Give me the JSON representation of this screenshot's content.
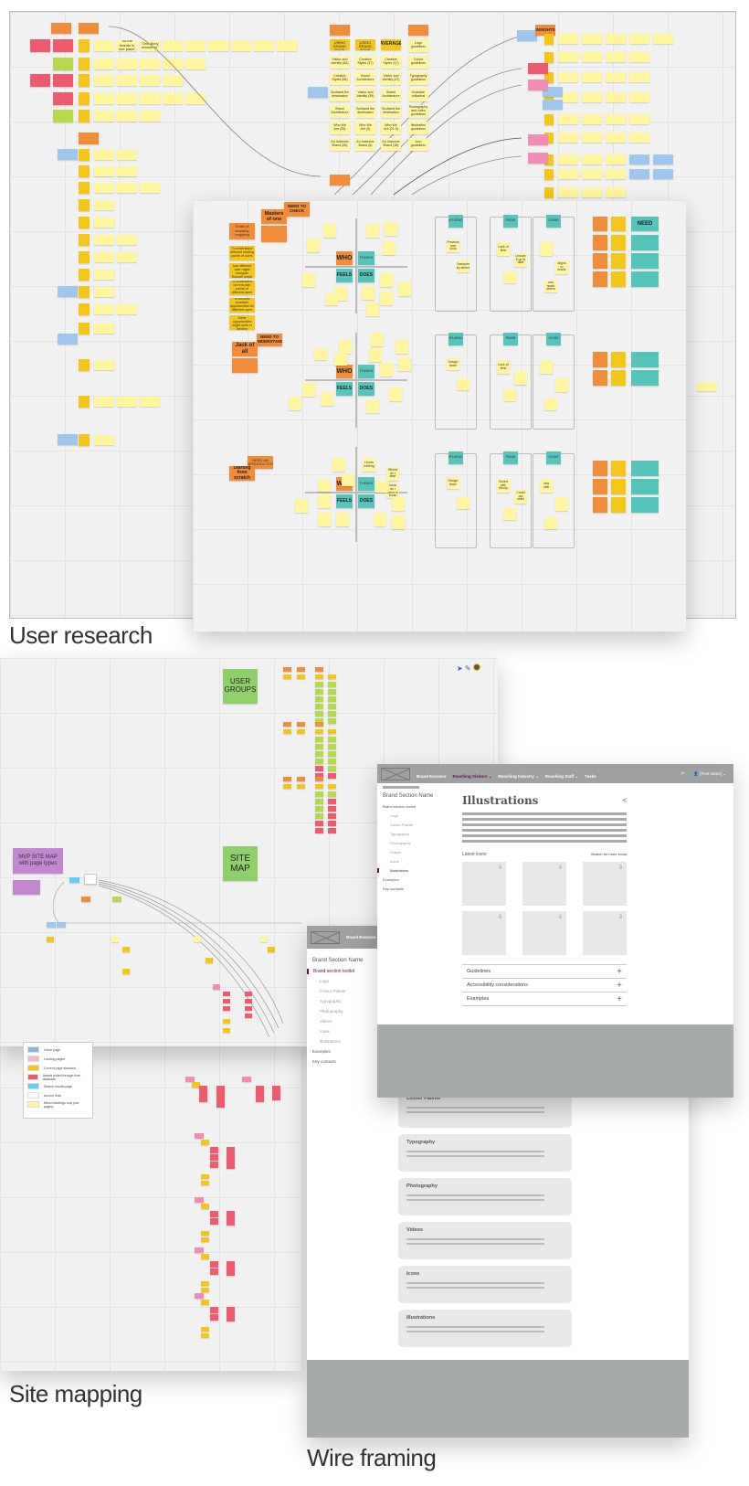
{
  "sections": {
    "user_research": "User research",
    "site_mapping": "Site mapping",
    "wire_framing": "Wire framing"
  },
  "research_board": {
    "summary_headers": [
      "BEFORE USING BRAND BOOK",
      "AFTER USING BRAND BOOK",
      "AVERAGE"
    ],
    "col_before": [
      "Visitor and Identity (82)",
      "Creative Styles (56)",
      "Scotland the destination",
      "Brand Architecture",
      "Who We Are (35)",
      "An Inclusive Brand (28)"
    ],
    "col_after": [
      "Creative Styles (37)",
      "Brand Architecture",
      "Visitor and Identity (39)",
      "Scotland the destination",
      "Who We Are (8)",
      "An Inclusive Brand (8)"
    ],
    "col_avg": [
      "Creative Styles (47)",
      "Visitor and Identity (47)",
      "Brand Architecture",
      "Scotland the destination",
      "Who We Are (21.5)",
      "An Inclusive Brand (18)"
    ],
    "guidelines": [
      "Logo guidelines",
      "Colour guidelines",
      "Typography guidelines",
      "Example collateral",
      "Photography and video guidelines",
      "Illustration guidelines",
      "Icon guidelines"
    ],
    "insights": "INSIGHTS",
    "notes_row1": [
      "'All the brands in one place'",
      "\"One likely missed to\""
    ]
  },
  "persona_board": {
    "need_to_check": "NEED TO CHECK",
    "persona1": "Masters of one",
    "empathy": "Goals of empathy mapping",
    "goals": [
      "To understand different starting points of users",
      "To understand how different user might navigate through portal",
      "To understand current pain points of different users",
      "To uncover possible opportunities for different users",
      "To map how these opportunities might work in tandem"
    ],
    "need_to_understand": "NEED TO UNDERSTAND",
    "persona2": "Jack of all",
    "need_intro": "NEED AN INTRODUCTION",
    "persona3": "Starting from scratch",
    "quadrants": [
      "WHO",
      "THINKS",
      "FEELS",
      "DOES"
    ],
    "columns": [
      "INFLUENCE",
      "PAINS",
      "GAINS"
    ],
    "need": "NEED",
    "pains1": [
      "Lack of time",
      "Unsure if up to date"
    ],
    "gains1": [
      "can teach others",
      "aligns to brand"
    ],
    "infl1": [
      "Previous own work",
      "Examples by others"
    ],
    "pains2": [
      "Lack of time"
    ],
    "infl2": [
      "Design team"
    ],
    "pains3": [
      "Bored with theory",
      "Could not skills"
    ],
    "gains3": [
      "new skill"
    ],
    "infl3": [
      "Design team"
    ],
    "thinks3": [
      "I know nothing",
      "Where do I start",
      "What do I need to know"
    ]
  },
  "sitemap": {
    "user_groups": "USER GROUPS",
    "site_map": "SITE MAP",
    "mvp": "MVP SITE MAP with page types",
    "legend": [
      "Home page",
      "Landing pages",
      "Current page standard",
      "Assets pulled through from database",
      "Search results page",
      "Anchor links",
      "Menu headings only (not pages)"
    ],
    "legend_colors": [
      "#8db3dc",
      "#f4b8cb",
      "#f5c518",
      "#ef5a6f",
      "#5bd0ef",
      "#ffffff",
      "#fff59d"
    ]
  },
  "wireframe_front": {
    "nav": [
      "Brand Essence",
      "Reaching Visitors ⌄",
      "Reaching Industry ⌄",
      "Reaching Staff ⌄",
      "Tasks"
    ],
    "user": "[First name] ⌄",
    "side_title": "Brand Section Name",
    "side_toolkit": "Brand section toolkit",
    "side_items": [
      "Logo",
      "Colour Palette",
      "Typography",
      "Photography",
      "Videos",
      "Icons",
      "Illustrations"
    ],
    "side_after": [
      "Examples",
      "Key contacts"
    ],
    "page_title": "Illustrations",
    "latest": "Latest icons",
    "search_more": "Search for more icons",
    "accordion": [
      "Guidelines",
      "Accessibility considerations",
      "Examples"
    ],
    "accent": "#6a0f49"
  },
  "wireframe_back": {
    "nav": "Brand Essence",
    "side_title": "Brand Section Name",
    "side_toolkit": "Brand section toolkit",
    "side_items": [
      "Logo",
      "Colour Palette",
      "Typography",
      "Photography",
      "Videos",
      "Icons",
      "Illustrations"
    ],
    "side_after": [
      "Examples",
      "Key contacts"
    ],
    "cards": [
      "Colour Palette",
      "Typography",
      "Photography",
      "Videos",
      "Icons",
      "Illustrations"
    ]
  }
}
